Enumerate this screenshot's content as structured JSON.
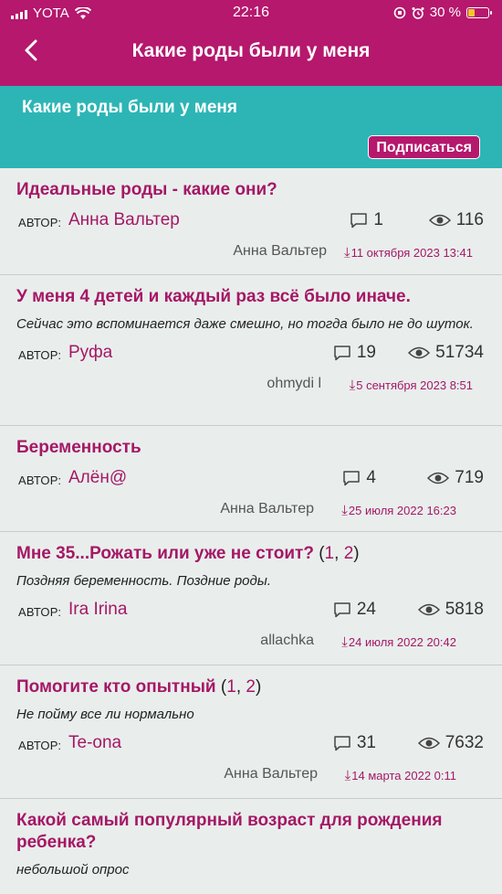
{
  "status": {
    "carrier": "YOTA",
    "time": "22:16",
    "battery": "30 %",
    "battery_level": 0.3
  },
  "header": {
    "title": "Какие роды были у меня"
  },
  "section": {
    "title": "Какие роды были у меня",
    "subscribe_label": "Подписаться"
  },
  "author_label": "АВТОР:",
  "topics": [
    {
      "title": "Идеальные роды - какие они?",
      "pages": [],
      "desc": "",
      "author": "Анна Вальтер",
      "comments": "1",
      "views": "116",
      "last_user": "Анна Вальтер",
      "last_date": "11 октября 2023 13:41"
    },
    {
      "title": "У меня 4 детей и каждый раз всё было иначе.",
      "pages": [],
      "desc": "Сейчас это вспоминается даже смешно, но тогда было не до шуток.",
      "author": "Руфа",
      "comments": "19",
      "views": "51734",
      "last_user": "ohmydi l",
      "last_date": "5 сентября 2023 8:51"
    },
    {
      "title": "Беременность",
      "pages": [],
      "desc": "",
      "author": "Алён@",
      "comments": "4",
      "views": "719",
      "last_user": "Анна Вальтер",
      "last_date": "25 июля 2022 16:23"
    },
    {
      "title": "Мне 35...Рожать или уже не стоит?",
      "pages": [
        "1",
        "2"
      ],
      "desc": "Поздняя беременность. Поздние роды.",
      "author": "Ira Irina",
      "comments": "24",
      "views": "5818",
      "last_user": "allachka",
      "last_date": "24 июля 2022 20:42"
    },
    {
      "title": "Помогите кто опытный",
      "pages": [
        "1",
        "2"
      ],
      "desc": "Не пойму все ли нормально",
      "author": "Te-ona",
      "comments": "31",
      "views": "7632",
      "last_user": "Анна Вальтер",
      "last_date": "14 марта 2022 0:11"
    },
    {
      "title": "Какой самый популярный возраст для рождения ребенка?",
      "pages": [],
      "desc": "небольшой опрос",
      "author": "",
      "comments": "",
      "views": "",
      "last_user": "",
      "last_date": ""
    }
  ]
}
